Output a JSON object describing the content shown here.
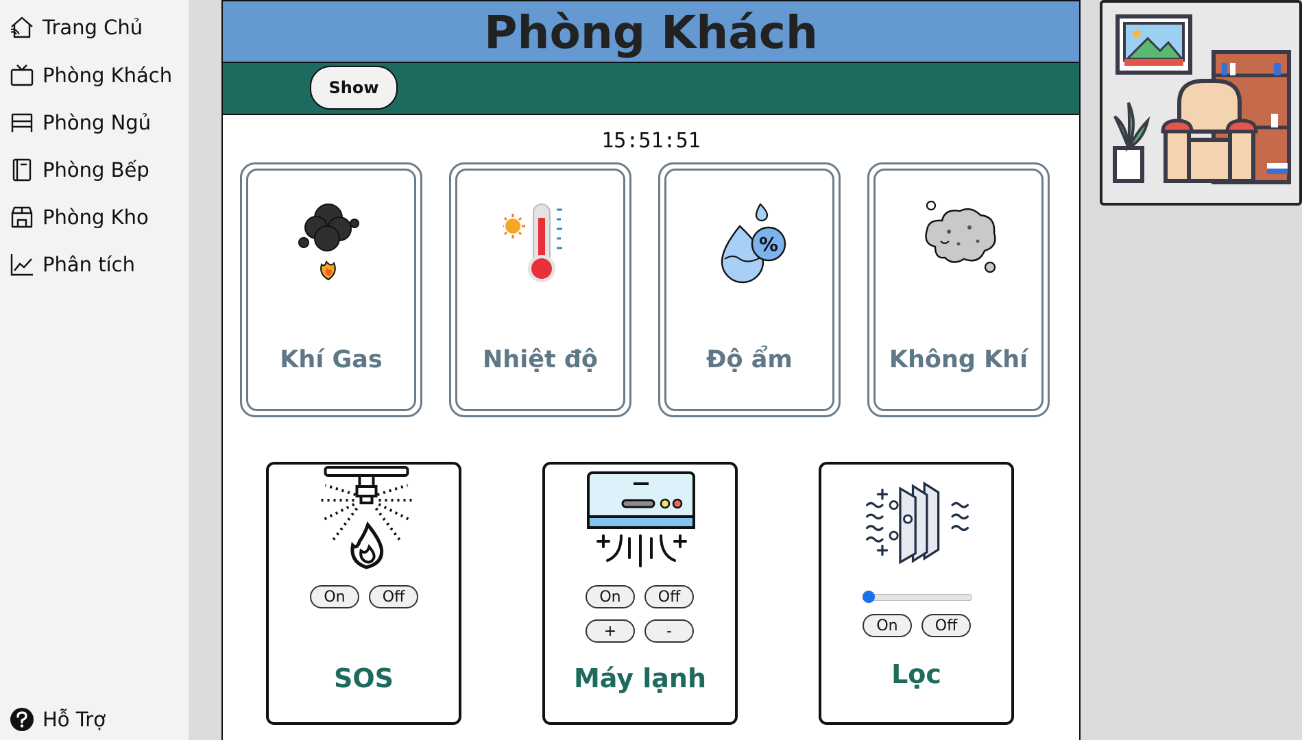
{
  "sidebar": {
    "items": [
      {
        "label": "Trang Chủ",
        "icon": "home-icon"
      },
      {
        "label": "Phòng Khách",
        "icon": "tv-icon"
      },
      {
        "label": "Phòng Ngủ",
        "icon": "bed-icon"
      },
      {
        "label": "Phòng Bếp",
        "icon": "book-icon"
      },
      {
        "label": "Phòng Kho",
        "icon": "store-icon"
      },
      {
        "label": "Phân tích",
        "icon": "chart-line-icon"
      }
    ],
    "help": {
      "label": "Hỗ Trợ",
      "icon": "question-icon"
    }
  },
  "header": {
    "title": "Phòng Khách"
  },
  "toolbar": {
    "show_label": "Show"
  },
  "clock": "15:51:51",
  "sensors": [
    {
      "label": "Khí Gas",
      "icon": "smoke-fire-icon"
    },
    {
      "label": "Nhiệt độ",
      "icon": "thermometer-icon"
    },
    {
      "label": "Độ ẩm",
      "icon": "humidity-icon"
    },
    {
      "label": "Không Khí",
      "icon": "air-cloud-icon"
    }
  ],
  "devices": {
    "sos": {
      "label": "SOS",
      "on": "On",
      "off": "Off",
      "icon": "sprinkler-icon"
    },
    "ac": {
      "label": "Máy lạnh",
      "on": "On",
      "off": "Off",
      "plus": "+",
      "minus": "-",
      "icon": "air-conditioner-icon"
    },
    "filter": {
      "label": "Lọc",
      "on": "On",
      "off": "Off",
      "icon": "air-filter-icon",
      "slider_level": 0
    }
  },
  "room_illustration": {
    "icon": "living-room-icon"
  },
  "colors": {
    "header_bg": "#6499d2",
    "subbar_bg": "#1d6a5f",
    "sensor_label": "#5f7888",
    "device_label": "#1d6a5f",
    "slider_thumb": "#1a73e8"
  }
}
